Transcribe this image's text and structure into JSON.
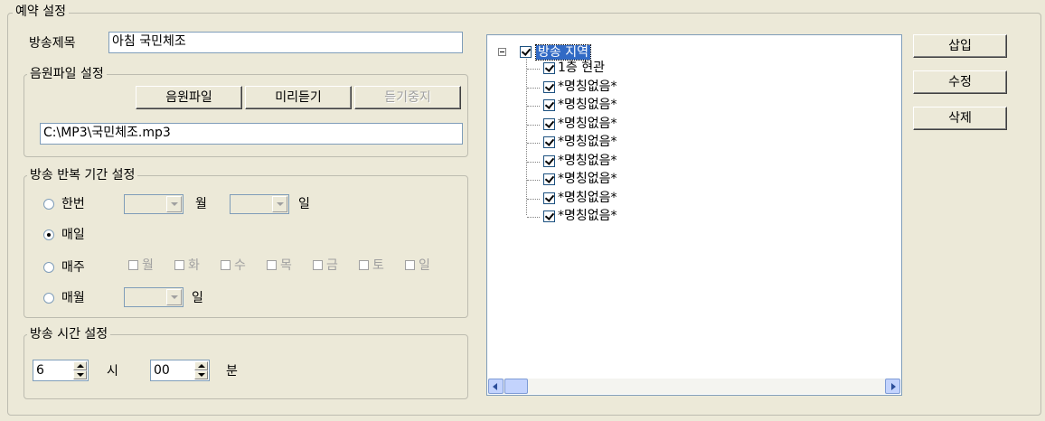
{
  "main_group": {
    "legend": "예약 설정"
  },
  "broadcast_title": {
    "label": "방송제목",
    "value": "아침 국민체조"
  },
  "audio_file": {
    "legend": "음원파일 설정",
    "btn_audio": "음원파일",
    "btn_preview": "미리듣기",
    "btn_stop": "듣기중지",
    "path": "C:\\MP3\\국민체조.mp3"
  },
  "repeat": {
    "legend": "방송 반복 기간 설정",
    "once": {
      "label": "한번",
      "month_unit": "월",
      "day_unit": "일"
    },
    "daily": {
      "label": "매일"
    },
    "weekly": {
      "label": "매주",
      "days": [
        "월",
        "화",
        "수",
        "목",
        "금",
        "토",
        "일"
      ]
    },
    "monthly": {
      "label": "매월",
      "day_unit": "일"
    },
    "selected": "daily"
  },
  "time": {
    "legend": "방송 시간 설정",
    "hour": "6",
    "hour_unit": "시",
    "minute": "00",
    "minute_unit": "분"
  },
  "tree": {
    "root": "방송 지역",
    "items": [
      "1층 현관",
      "*명칭없음*",
      "*명칭없음*",
      "*명칭없음*",
      "*명칭없음*",
      "*명칭없음*",
      "*명칭없음*",
      "*명칭없음*",
      "*명칭없음*"
    ]
  },
  "actions": {
    "insert": "삽입",
    "edit": "수정",
    "delete": "삭제"
  }
}
